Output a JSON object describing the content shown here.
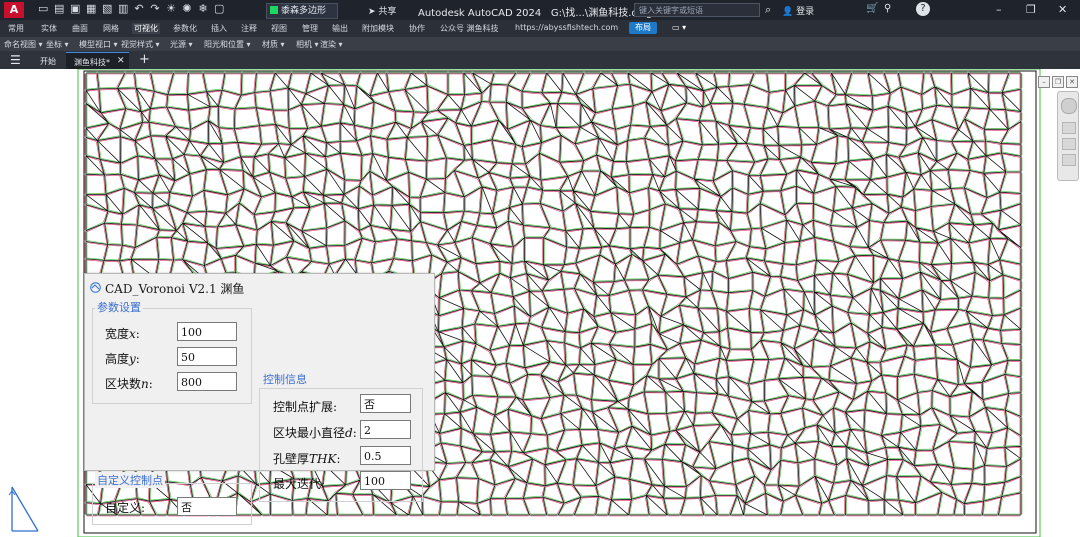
{
  "titlebar": {
    "logo": "A",
    "layer_label": "黍森多边形",
    "share_label": "共享",
    "app_title": "Autodesk AutoCAD 2024",
    "file_path": "G:\\找...\\渊鱼科技.dwg",
    "search_placeholder": "键入关键字或短语",
    "login_label": "登录",
    "help_label": "?",
    "min_glyph": "–",
    "max_glyph": "❐",
    "close_glyph": "✕"
  },
  "ribbon": {
    "tabs": [
      "常用",
      "实体",
      "曲面",
      "网格",
      "可视化",
      "参数化",
      "插入",
      "注释",
      "视图",
      "管理",
      "输出",
      "附加模块",
      "协作",
      "公众号 渊鱼科技",
      "https://abyssfishtech.com"
    ],
    "active_tab": "可视化",
    "layout_button": "布局"
  },
  "panels": {
    "items": [
      "命名视图",
      "坐标",
      "模型视口",
      "视觉样式",
      "光源",
      "阳光和位置",
      "材质",
      "相机",
      "渲染"
    ]
  },
  "doctabs": {
    "start_label": "开始",
    "doc_label": "渊鱼科技*",
    "close_glyph": "✕",
    "plus_glyph": "+"
  },
  "dialog": {
    "title": "CAD_Voronoi V2.1 渊鱼",
    "params": {
      "group_title": "参数设置",
      "width_label": "宽度",
      "width_var": "x",
      "width_value": "100",
      "height_label": "高度",
      "height_var": "y",
      "height_value": "50",
      "count_label": "区块数",
      "count_var": "n",
      "count_value": "800"
    },
    "control": {
      "group_title": "控制信息",
      "expand_label": "控制点扩展:",
      "expand_value": "否",
      "mindiam_label": "区块最小直径",
      "mindiam_var": "d",
      "mindiam_value": "2",
      "thk_label": "孔壁厚",
      "thk_var": "THK",
      "thk_value": "0.5",
      "iter_label": "最大迭代:",
      "iter_value": "100"
    },
    "custom": {
      "group_title": "自定义控制点",
      "custom_label": "自定义:",
      "custom_value": "否"
    }
  },
  "colors": {
    "titlebar_bg": "#1f232b",
    "ribbon_bg": "#2b2f38",
    "layout_button_bg": "#1e7ac8",
    "group_title": "#3a6fd0",
    "voronoi_line_black": "#111111",
    "voronoi_line_red": "#e0306a",
    "voronoi_line_green": "#3ec23e"
  }
}
